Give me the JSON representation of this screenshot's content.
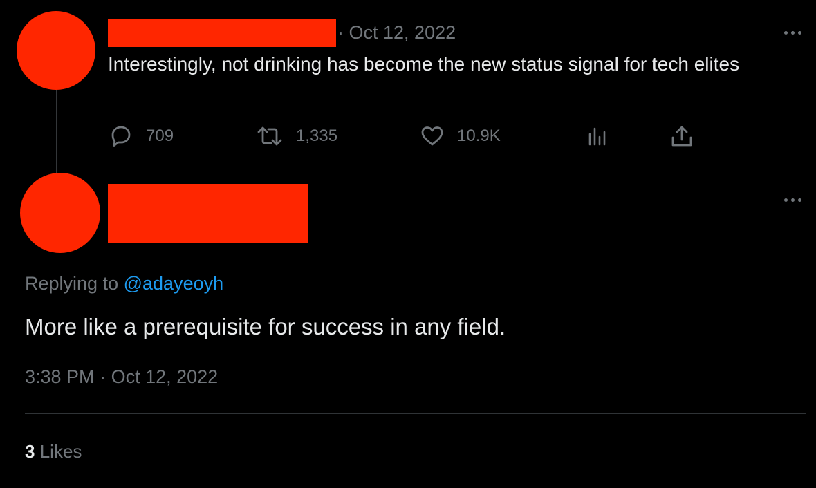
{
  "parent_tweet": {
    "separator": "·",
    "date": "Oct 12, 2022",
    "text": "Interestingly, not drinking has become the new status signal for tech elites",
    "actions": {
      "replies": "709",
      "reposts": "1,335",
      "likes": "10.9K"
    },
    "icons": [
      "reply-icon",
      "repost-icon",
      "like-icon",
      "views-icon",
      "share-icon"
    ]
  },
  "reply_tweet": {
    "replying_prefix": "Replying to",
    "replying_handle": "@adayeoyh",
    "text": "More like a prerequisite for success in any field.",
    "time": "3:38 PM",
    "separator": "·",
    "date": "Oct 12, 2022",
    "likes_count": "3",
    "likes_label": "Likes"
  },
  "colors": {
    "background": "#000000",
    "redaction": "#ff2600",
    "primary_text": "#e7e9ea",
    "secondary_text": "#71767b",
    "link": "#1d9bf0",
    "divider": "#2f3336"
  }
}
